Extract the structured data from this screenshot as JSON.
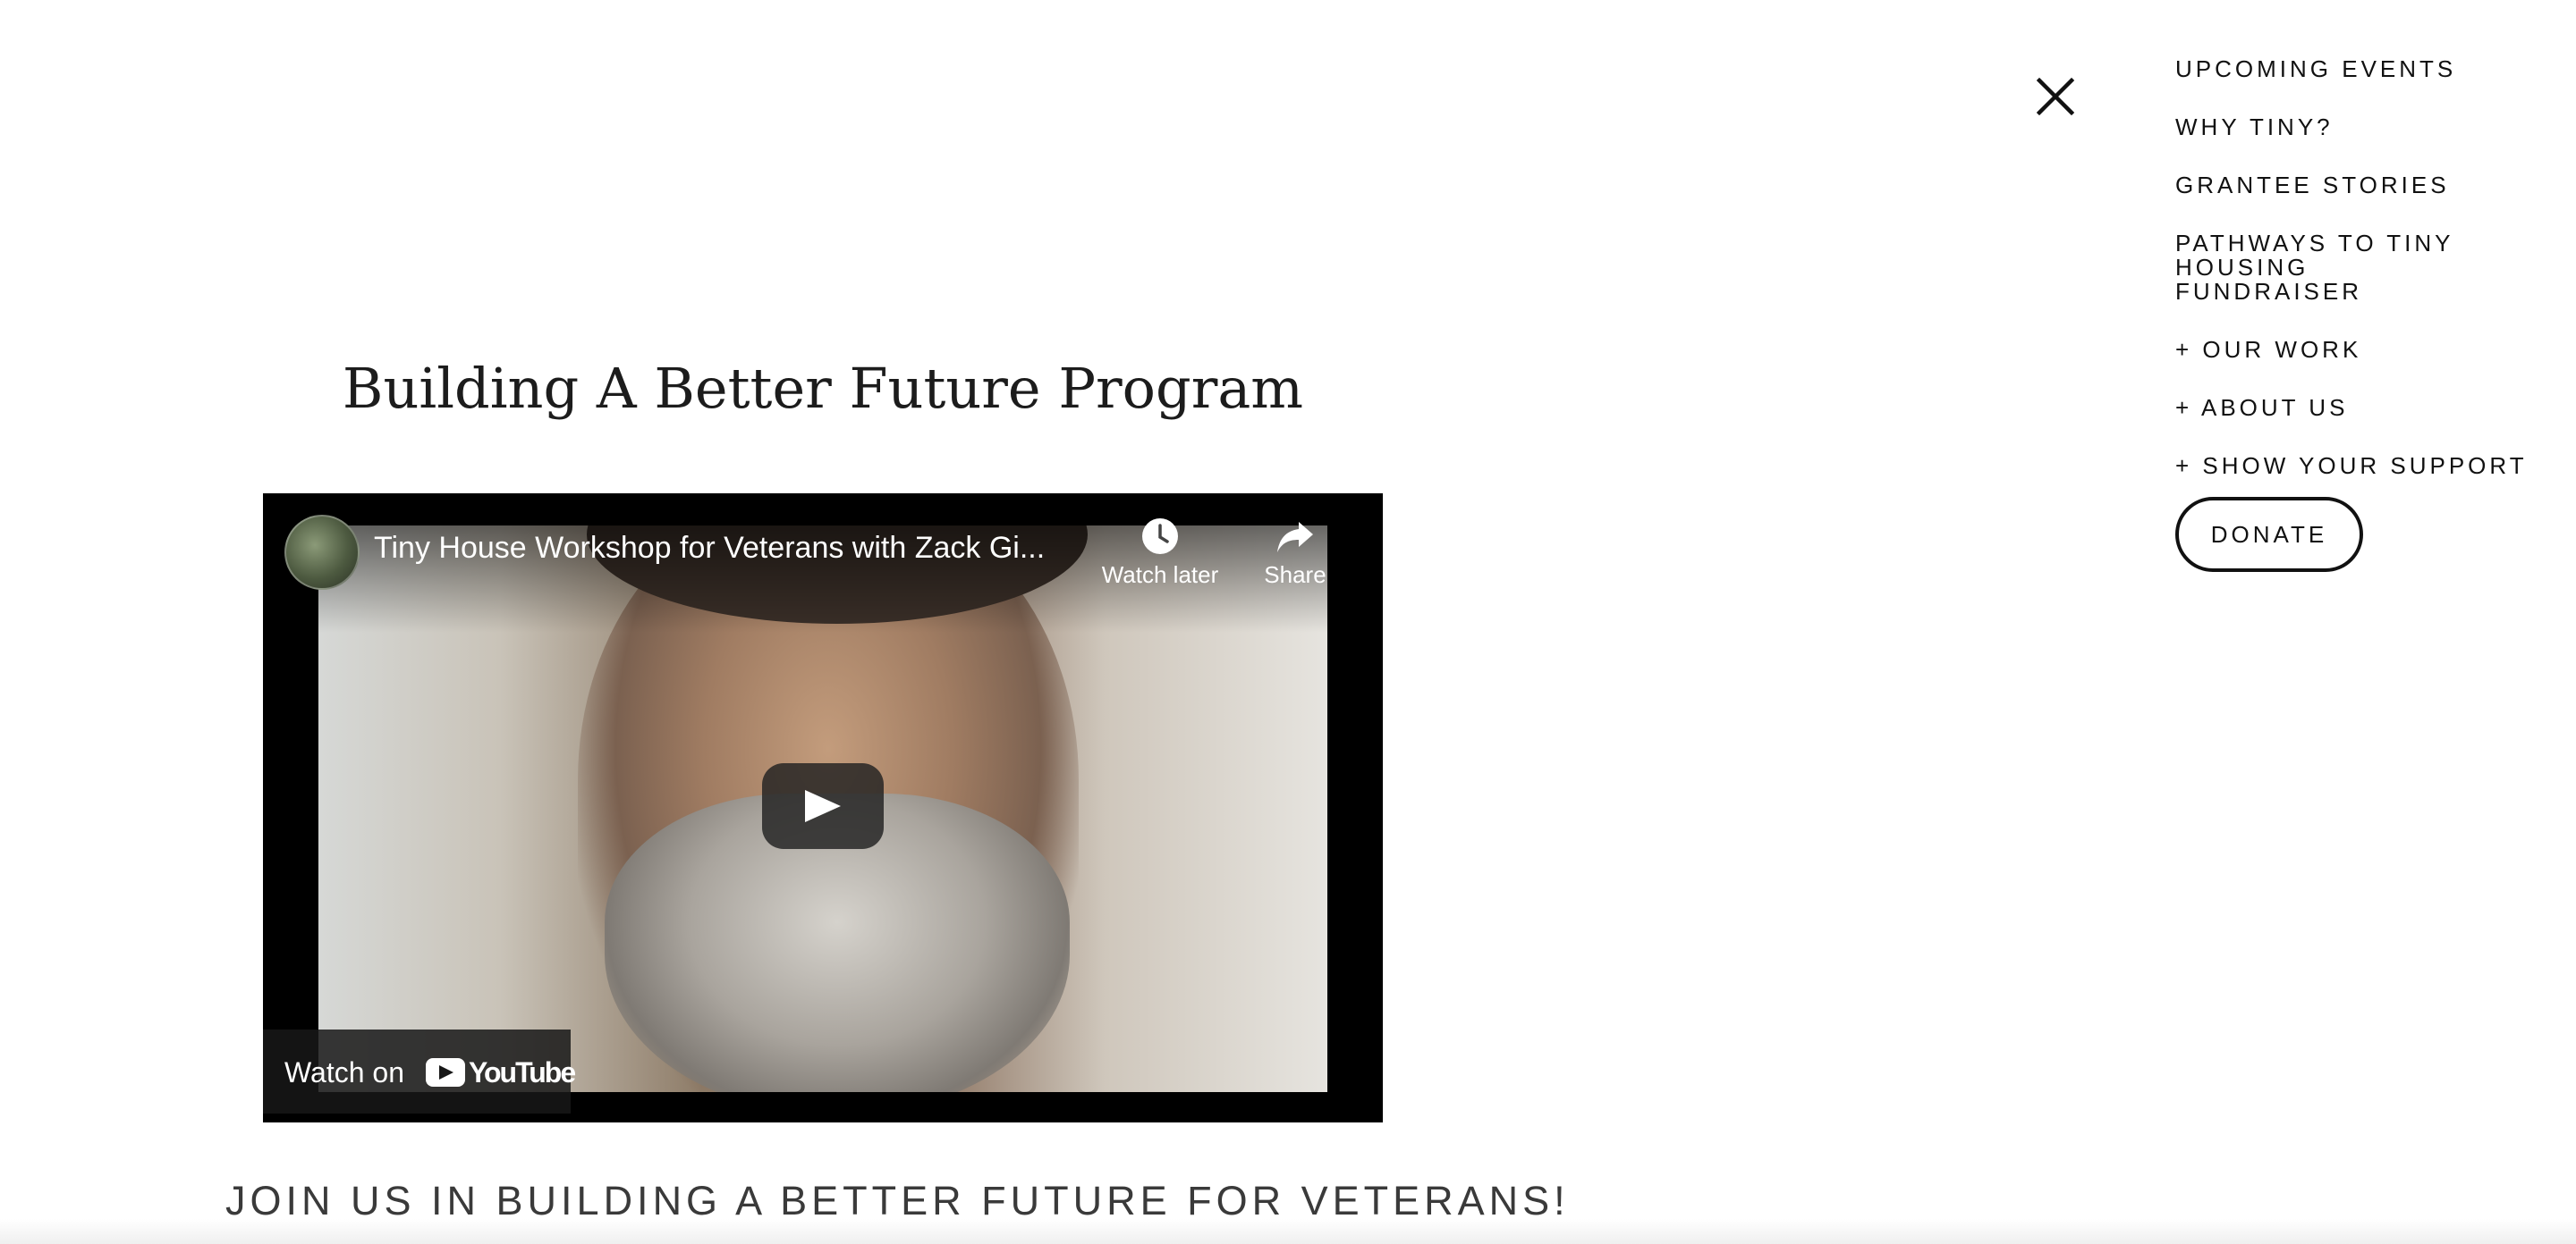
{
  "page": {
    "title": "Building A Better Future Program",
    "cta_heading": "JOIN US IN BUILDING A BETTER FUTURE FOR VETERANS!"
  },
  "video": {
    "title": "Tiny House Workshop for Veterans with Zack Gi...",
    "watch_later_label": "Watch later",
    "share_label": "Share",
    "watch_on_label": "Watch on",
    "platform_name": "YouTube",
    "icons": {
      "avatar": "channel-avatar",
      "watch_later": "clock-icon",
      "share": "share-arrow-icon",
      "play": "play-icon",
      "logo": "youtube-logo-icon"
    }
  },
  "menu": {
    "close_icon": "close-icon",
    "items": [
      {
        "label": "UPCOMING EVENTS"
      },
      {
        "label": "WHY TINY?"
      },
      {
        "label": "GRANTEE STORIES"
      },
      {
        "label": "PATHWAYS TO TINY HOUSING FUNDRAISER"
      },
      {
        "label": "+ OUR WORK"
      },
      {
        "label": "+ ABOUT US"
      },
      {
        "label": "+ SHOW YOUR SUPPORT"
      }
    ],
    "donate_label": "DONATE"
  },
  "colors": {
    "text": "#1a1a1a",
    "video_bg": "#000000",
    "cta_text": "#3a3a3a",
    "background": "#ffffff"
  }
}
